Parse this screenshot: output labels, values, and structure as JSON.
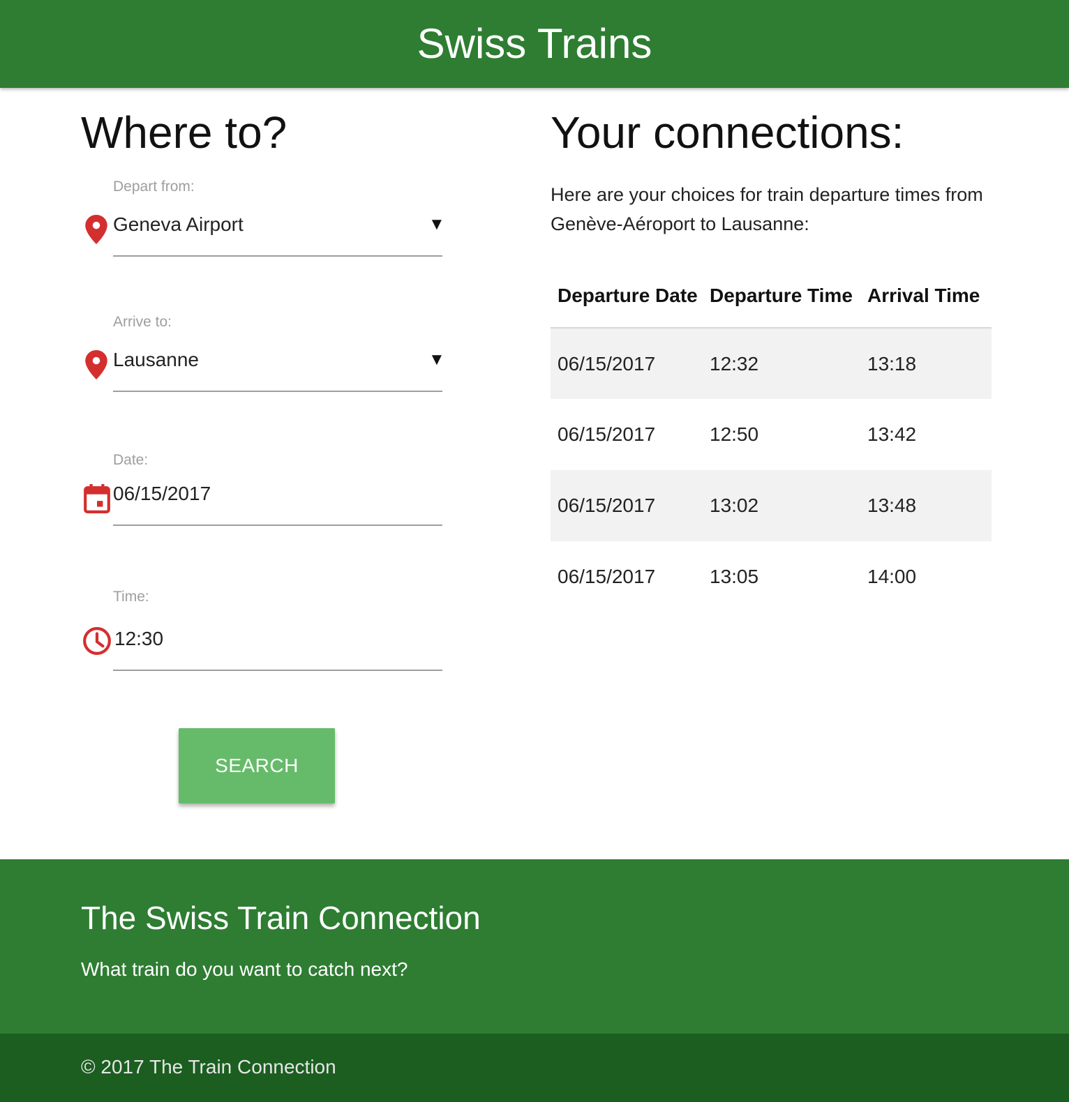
{
  "header": {
    "title": "Swiss Trains"
  },
  "form": {
    "title": "Where to?",
    "depart": {
      "label": "Depart from:",
      "value": "Geneva Airport",
      "icon": "map-pin-icon"
    },
    "arrive": {
      "label": "Arrive to:",
      "value": "Lausanne",
      "icon": "map-pin-icon"
    },
    "date": {
      "label": "Date:",
      "value": "06/15/2017",
      "icon": "calendar-icon"
    },
    "time": {
      "label": "Time:",
      "value": "12:30",
      "icon": "clock-icon"
    },
    "search_label": "Search",
    "caret": "▼"
  },
  "results": {
    "title": "Your connections:",
    "intro": "Here are your choices for train departure times from Genève-Aéroport to Lausanne:",
    "columns": [
      "Departure Date",
      "Departure Time",
      "Arrival Time"
    ],
    "rows": [
      [
        "06/15/2017",
        "12:32",
        "13:18"
      ],
      [
        "06/15/2017",
        "12:50",
        "13:42"
      ],
      [
        "06/15/2017",
        "13:02",
        "13:48"
      ],
      [
        "06/15/2017",
        "13:05",
        "14:00"
      ]
    ]
  },
  "footer": {
    "title": "The Swiss Train Connection",
    "tagline": "What train do you want to catch next?",
    "copyright": "© 2017 The Train Connection"
  },
  "colors": {
    "primary": "#2e7d32",
    "primary_dark": "#1b5e20",
    "button": "#66bb6a",
    "icon": "#d32f2f",
    "row_stripe": "#f2f2f2"
  }
}
